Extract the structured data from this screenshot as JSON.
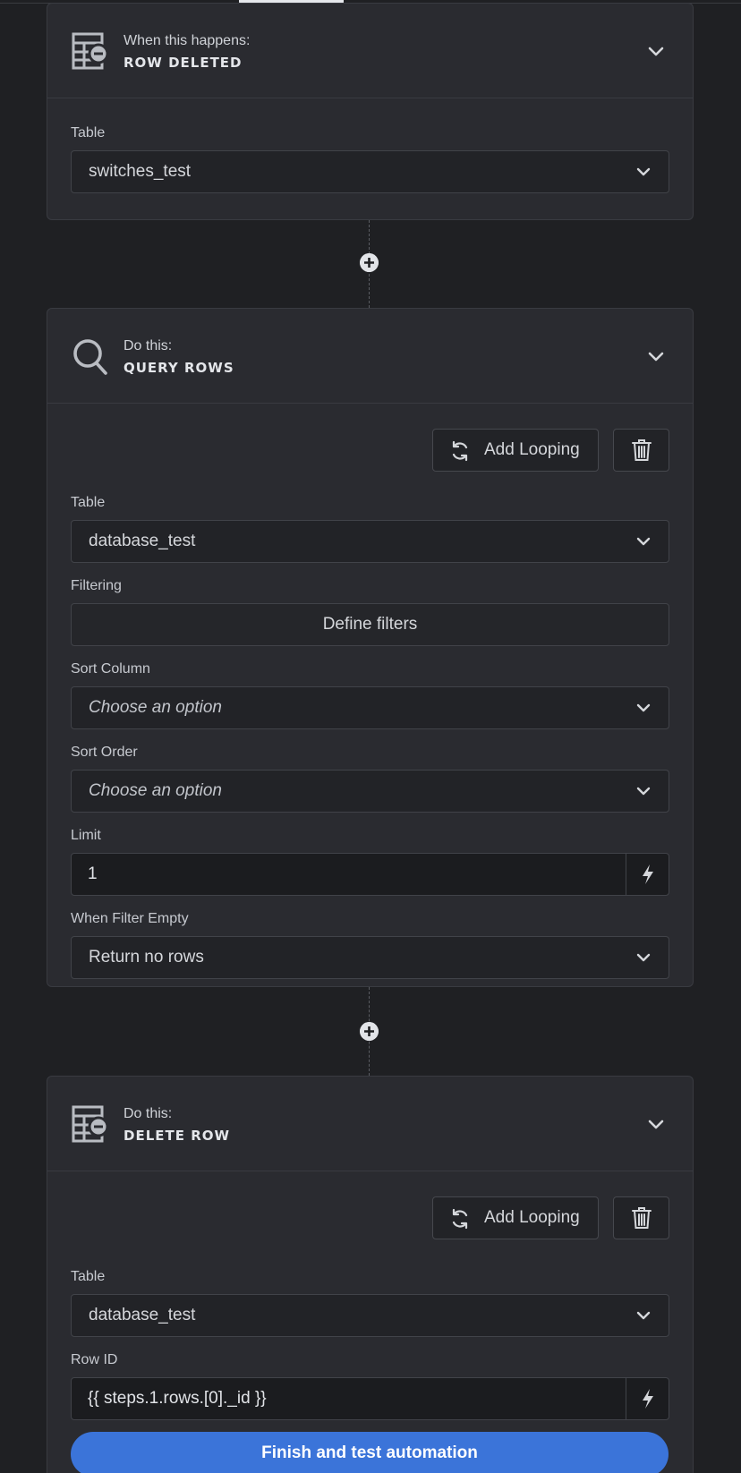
{
  "trigger": {
    "title": "When this happens:",
    "subtitle": "ROW DELETED",
    "table_label": "Table",
    "table_value": "switches_test"
  },
  "query_step": {
    "title": "Do this:",
    "subtitle": "QUERY ROWS",
    "add_looping_label": "Add Looping",
    "table_label": "Table",
    "table_value": "database_test",
    "filtering_label": "Filtering",
    "define_filters_label": "Define filters",
    "sort_column_label": "Sort Column",
    "sort_column_value": "Choose an option",
    "sort_order_label": "Sort Order",
    "sort_order_value": "Choose an option",
    "limit_label": "Limit",
    "limit_value": "1",
    "when_filter_empty_label": "When Filter Empty",
    "when_filter_empty_value": "Return no rows"
  },
  "delete_step": {
    "title": "Do this:",
    "subtitle": "DELETE ROW",
    "add_looping_label": "Add Looping",
    "table_label": "Table",
    "table_value": "database_test",
    "row_id_label": "Row ID",
    "row_id_value": "{{ steps.1.rows.[0]._id }}"
  },
  "finish_label": "Finish and test automation",
  "icons": {
    "row_action": "table-minus-icon",
    "query": "magnifier-icon",
    "collapse": "chevron-down-icon",
    "select": "chevron-down-icon",
    "loop": "sync-arrows-icon",
    "delete": "trash-icon",
    "binding": "lightning-bolt-icon",
    "add_step": "plus-circle-icon"
  },
  "colors": {
    "background": "#1f2023",
    "card": "#2a2b30",
    "primary_button": "#3b74d9"
  }
}
